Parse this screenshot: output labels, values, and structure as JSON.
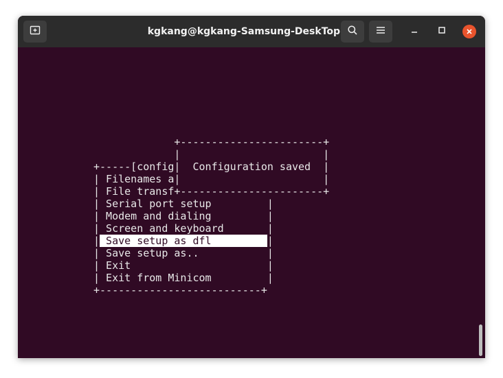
{
  "window": {
    "title": "kgkang@kgkang-Samsung-DeskTop: ~"
  },
  "icons": {
    "new_tab": "new-tab-icon",
    "search": "search-icon",
    "menu": "hamburger-menu-icon",
    "minimize": "minimize-icon",
    "maximize": "maximize-icon",
    "close": "close-icon",
    "close_color": "#e9542d"
  },
  "colors": {
    "terminal_bg": "#300a24",
    "titlebar_bg": "#2c2c2c",
    "text": "#e8e8e8",
    "highlight_bg": "#ffffff"
  },
  "terminal": {
    "lines": [
      "             +-----------------------+",
      "             |                       |",
      "+-----[config|  Configuration saved  |",
      "| Filenames a|                       |",
      "| File transf+-----------------------+",
      "| Serial port setup         |",
      "| Modem and dialing         |",
      "| Screen and keyboard       |",
      "|",
      "| Save setup as..           |",
      "| Exit                      |",
      "| Exit from Minicom         |",
      "+--------------------------+"
    ],
    "selected_item": " Save setup as dfl         ",
    "selected_suffix": "|"
  }
}
